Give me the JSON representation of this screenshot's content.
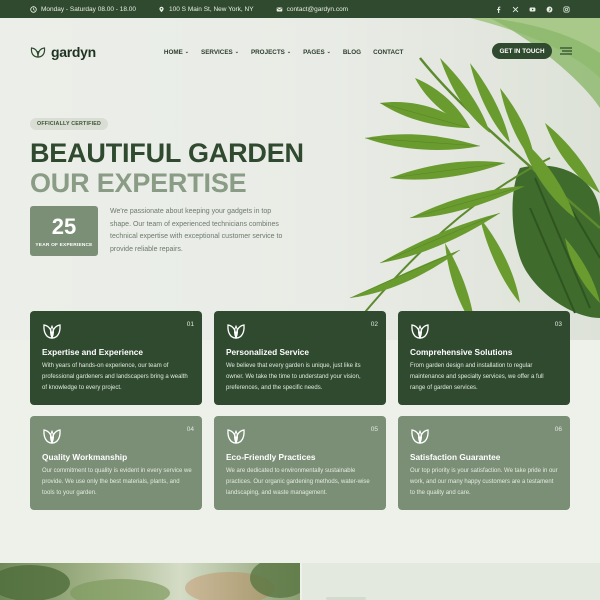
{
  "topbar": {
    "hours": "Monday - Saturday 08.00 - 18.00",
    "address": "100 S Main St, New York, NY",
    "email": "contact@gardyn.com",
    "social": [
      "facebook-icon",
      "x-icon",
      "youtube-icon",
      "pinterest-icon",
      "instagram-icon"
    ]
  },
  "nav": {
    "brand": "gardyn",
    "items": [
      {
        "label": "HOME",
        "dropdown": true
      },
      {
        "label": "SERVICES",
        "dropdown": true
      },
      {
        "label": "PROJECTS",
        "dropdown": true
      },
      {
        "label": "PAGES",
        "dropdown": true
      },
      {
        "label": "BLOG",
        "dropdown": false
      },
      {
        "label": "CONTACT",
        "dropdown": false
      }
    ],
    "cta": "GET IN TOUCH",
    "chevron": "⌄"
  },
  "hero": {
    "badge": "OFFICIALLY CERTIFIED",
    "title_line1": "BEAUTIFUL GARDEN",
    "title_line2": "OUR EXPERTISE",
    "stat_number": "25",
    "stat_label": "YEAR OF EXPERIENCE",
    "description": "We're passionate about keeping your gadgets in top shape. Our team of experienced technicians combines technical expertise with exceptional customer service to provide reliable repairs."
  },
  "cards": [
    {
      "num": "01",
      "title": "Expertise and Experience",
      "text": "With years of hands-on experience, our team of professional gardeners and landscapers bring a wealth of knowledge to every project."
    },
    {
      "num": "02",
      "title": "Personalized Service",
      "text": "We believe that every garden is unique, just like its owner. We take the time to understand your vision, preferences, and the specific needs."
    },
    {
      "num": "03",
      "title": "Comprehensive Solutions",
      "text": "From garden design and installation to regular maintenance and specialty services, we offer a full range of garden services."
    },
    {
      "num": "04",
      "title": "Quality Workmanship",
      "text": "Our commitment to quality is evident in every service we provide. We use only the best materials, plants, and tools to your garden."
    },
    {
      "num": "05",
      "title": "Eco-Friendly Practices",
      "text": "We are dedicated to environmentally sustainable practices. Our organic gardening methods, water-wise landscaping, and waste management."
    },
    {
      "num": "06",
      "title": "Satisfaction Guarantee",
      "text": "Our top priority is your satisfaction. We take pride in our work, and our many happy customers are a testament to the quality and care."
    }
  ],
  "colors": {
    "primary": "#2f4a2f",
    "secondary": "#7a8f76",
    "title_light": "#8a9c85",
    "background": "#eef1ea"
  }
}
